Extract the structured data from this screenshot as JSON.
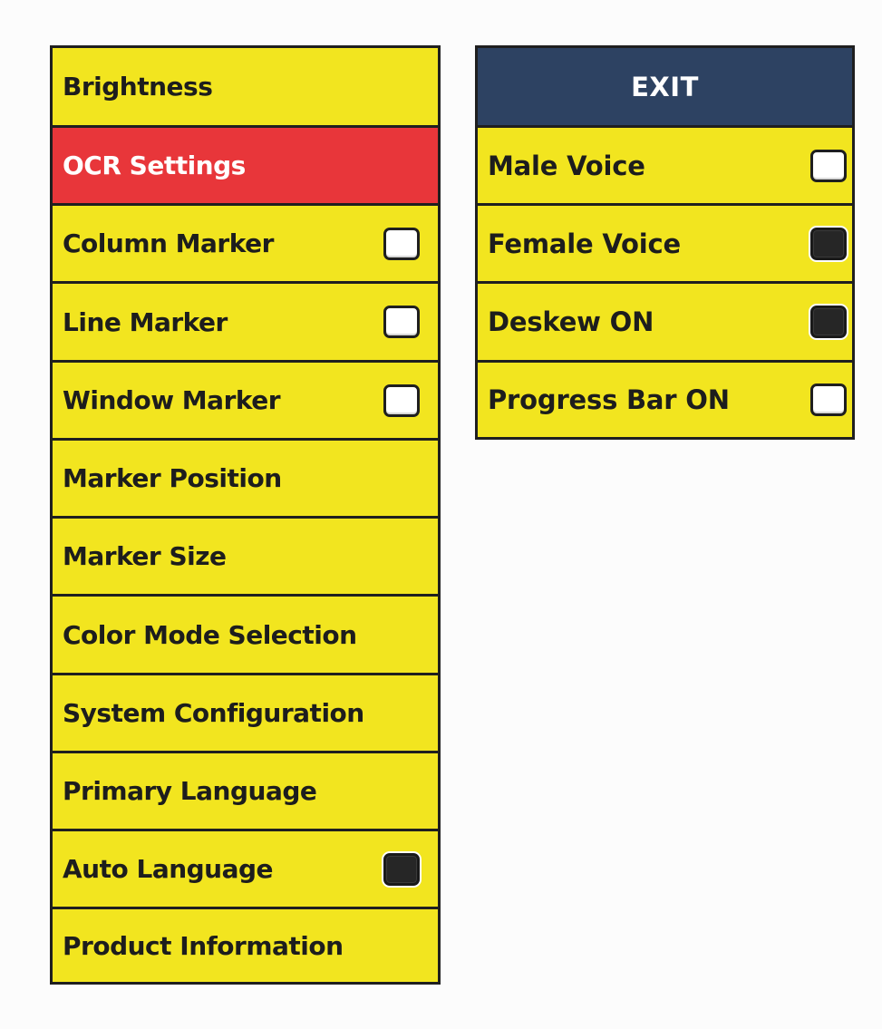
{
  "main_menu": {
    "items": [
      {
        "label": "Brightness"
      },
      {
        "label": "OCR Settings"
      },
      {
        "label": "Column Marker",
        "checked": false
      },
      {
        "label": "Line Marker",
        "checked": false
      },
      {
        "label": "Window Marker",
        "checked": false
      },
      {
        "label": "Marker Position"
      },
      {
        "label": "Marker Size"
      },
      {
        "label": "Color Mode Selection"
      },
      {
        "label": "System Configuration"
      },
      {
        "label": "Primary Language"
      },
      {
        "label": "Auto Language",
        "checked": true
      },
      {
        "label": "Product Information"
      }
    ],
    "selected": "OCR Settings"
  },
  "sub_menu": {
    "exit_label": "EXIT",
    "items": [
      {
        "label": "Male Voice",
        "checked": false
      },
      {
        "label": "Female Voice",
        "checked": true
      },
      {
        "label": "Deskew ON",
        "checked": true
      },
      {
        "label": "Progress Bar ON",
        "checked": false
      }
    ]
  },
  "colors": {
    "menu_background": "#f2e51f",
    "selected_background": "#e8363a",
    "exit_background": "#2d4262",
    "border": "#1f1f1f"
  }
}
